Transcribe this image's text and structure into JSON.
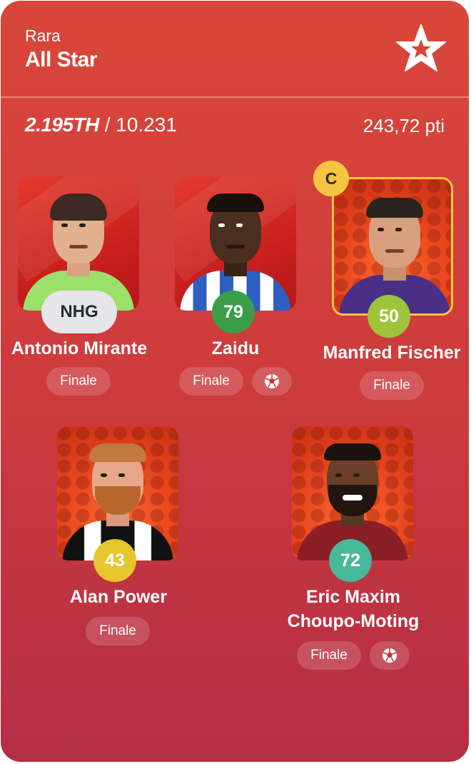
{
  "header": {
    "rarity": "Rara",
    "title": "All Star",
    "logo_icon": "star-logo-icon"
  },
  "stats": {
    "rank": "2.195TH",
    "total": "10.231",
    "score": "243,72 pti"
  },
  "colors": {
    "card_top": "#d9473a",
    "card_bottom": "#b42e45",
    "captain": "#f5c542"
  },
  "players": [
    {
      "name": "Antonio Mirante",
      "score": "NHG",
      "badge_color": "#e5e5ea",
      "status": "Finale",
      "goal": false
    },
    {
      "name": "Zaidu",
      "score": "79",
      "badge_color": "#3a9e48",
      "status": "Finale",
      "goal": true
    },
    {
      "name": "Manfred Fischer",
      "score": "50",
      "badge_color": "#9dc43a",
      "status": "Finale",
      "goal": false,
      "captain": "C"
    },
    {
      "name": "Alan Power",
      "score": "43",
      "badge_color": "#e6c62c",
      "status": "Finale",
      "goal": false
    },
    {
      "name": "Eric Maxim\nChoupo-Moting",
      "name_line1": "Eric Maxim",
      "name_line2": "Choupo-Moting",
      "score": "72",
      "badge_color": "#48b89a",
      "status": "Finale",
      "goal": true
    }
  ]
}
